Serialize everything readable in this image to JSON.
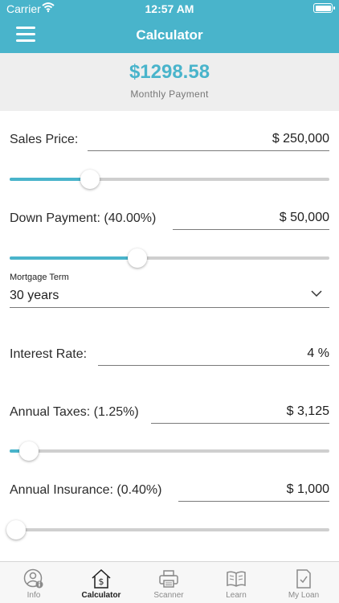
{
  "status": {
    "carrier": "Carrier",
    "time": "12:57 AM",
    "wifi_icon": "wifi-icon",
    "battery_icon": "battery-icon"
  },
  "nav": {
    "title": "Calculator",
    "menu_icon": "hamburger-menu-icon"
  },
  "summary": {
    "payment": "$1298.58",
    "label": "Monthly Payment"
  },
  "fields": {
    "sales_price": {
      "label": "Sales Price:",
      "value": "$ 250,000",
      "slider_level": 0.25
    },
    "down_payment": {
      "label": "Down Payment: (40.00%)",
      "value": "$ 50,000",
      "slider_level": 0.4
    },
    "mortgage_term": {
      "caption": "Mortgage Term",
      "value": "30 years"
    },
    "interest_rate": {
      "label": "Interest Rate:",
      "value": "4 %"
    },
    "annual_taxes": {
      "label": "Annual Taxes: (1.25%)",
      "value": "$ 3,125",
      "slider_level": 0.06
    },
    "annual_insurance": {
      "label": "Annual Insurance: (0.40%)",
      "value": "$ 1,000",
      "slider_level": 0.02
    }
  },
  "tabs": [
    {
      "label": "Info",
      "icon": "person-info-icon"
    },
    {
      "label": "Calculator",
      "icon": "house-dollar-icon"
    },
    {
      "label": "Scanner",
      "icon": "printer-scanner-icon"
    },
    {
      "label": "Learn",
      "icon": "open-book-icon"
    },
    {
      "label": "My Loan",
      "icon": "document-check-icon"
    }
  ],
  "colors": {
    "accent": "#49b4cb",
    "summary_bg": "#eeeeee",
    "track": "#cfcfcf"
  }
}
